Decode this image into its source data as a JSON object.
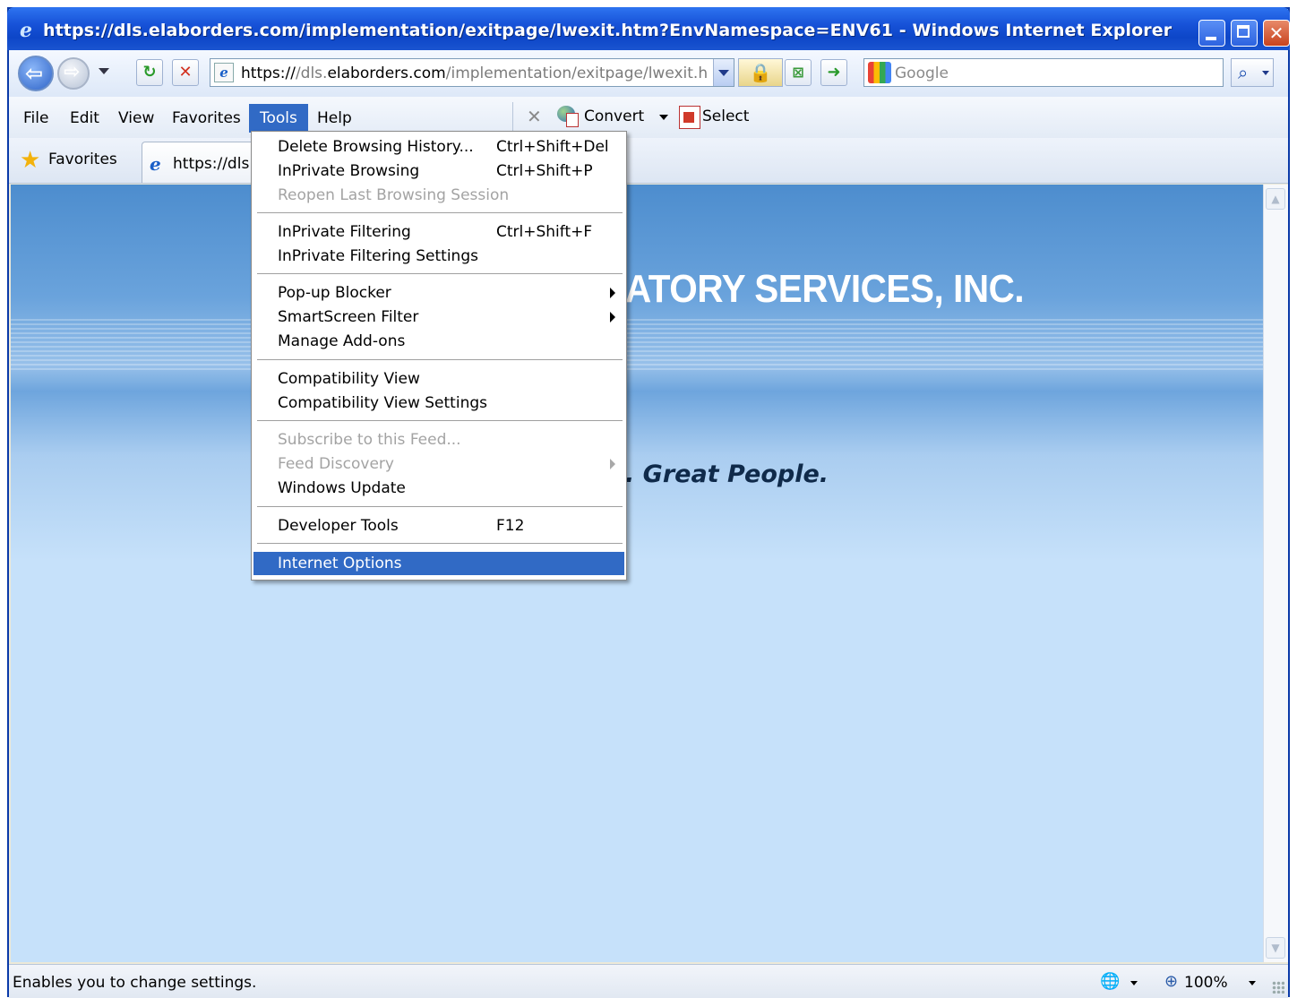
{
  "window": {
    "title": "https://dls.elaborders.com/implementation/exitpage/lwexit.htm?EnvNamespace=ENV61 - Windows Internet Explorer"
  },
  "address_bar": {
    "url_parts": [
      "https://",
      "/dls.",
      "elaborders.com",
      "/implementation/exitpage/lwexit.htm?Env"
    ],
    "search_placeholder": "Google"
  },
  "menubar": {
    "items": [
      "File",
      "Edit",
      "View",
      "Favorites",
      "Tools",
      "Help"
    ],
    "active": "Tools"
  },
  "toolbar": {
    "convert_label": "Convert",
    "select_label": "Select"
  },
  "favorites_bar": {
    "label": "Favorites",
    "tab_title": "https://dls.elaborders.com"
  },
  "page": {
    "company_fragment": "ATORY SERVICES, INC.",
    "tagline_fragment": ". Great People."
  },
  "tools_menu": {
    "items": [
      {
        "label": "Delete Browsing History...",
        "shortcut": "Ctrl+Shift+Del",
        "disabled": false
      },
      {
        "label": "InPrivate Browsing",
        "shortcut": "Ctrl+Shift+P",
        "disabled": false
      },
      {
        "label": "Reopen Last Browsing Session",
        "shortcut": "",
        "disabled": true
      },
      {
        "label": "InPrivate Filtering",
        "shortcut": "Ctrl+Shift+F",
        "disabled": false
      },
      {
        "label": "InPrivate Filtering Settings",
        "shortcut": "",
        "disabled": false
      },
      {
        "label": "Pop-up Blocker",
        "shortcut": "",
        "disabled": false,
        "submenu": true
      },
      {
        "label": "SmartScreen Filter",
        "shortcut": "",
        "disabled": false,
        "submenu": true
      },
      {
        "label": "Manage Add-ons",
        "shortcut": "",
        "disabled": false
      },
      {
        "label": "Compatibility View",
        "shortcut": "",
        "disabled": false
      },
      {
        "label": "Compatibility View Settings",
        "shortcut": "",
        "disabled": false
      },
      {
        "label": "Subscribe to this Feed...",
        "shortcut": "",
        "disabled": true
      },
      {
        "label": "Feed Discovery",
        "shortcut": "",
        "disabled": true,
        "submenu": true
      },
      {
        "label": "Windows Update",
        "shortcut": "",
        "disabled": false
      },
      {
        "label": "Developer Tools",
        "shortcut": "F12",
        "disabled": false
      },
      {
        "label": "Internet Options",
        "shortcut": "",
        "disabled": false,
        "highlighted": true
      }
    ]
  },
  "status_bar": {
    "text": "Enables you to change settings.",
    "zoom": "100%"
  }
}
